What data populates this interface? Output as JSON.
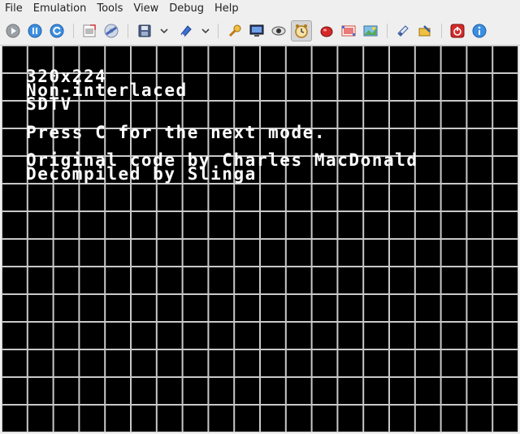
{
  "menu": {
    "file": "File",
    "emulation": "Emulation",
    "tools": "Tools",
    "view": "View",
    "debug": "Debug",
    "help": "Help"
  },
  "toolbar": {
    "items": [
      {
        "name": "play-icon"
      },
      {
        "name": "pause-icon"
      },
      {
        "name": "reset-icon"
      },
      {
        "name": "screenshot-icon"
      },
      {
        "name": "cd-icon"
      },
      {
        "name": "save-state-icon"
      },
      {
        "name": "load-state-icon"
      },
      {
        "name": "cheats-icon"
      },
      {
        "name": "display-icon"
      },
      {
        "name": "vram-icon"
      },
      {
        "name": "timer-icon"
      },
      {
        "name": "cpu-icon"
      },
      {
        "name": "memory-icon"
      },
      {
        "name": "palette-icon"
      },
      {
        "name": "patch-icon"
      },
      {
        "name": "settings-icon"
      },
      {
        "name": "power-icon"
      },
      {
        "name": "info-icon"
      }
    ]
  },
  "screen": {
    "line1": "320x224",
    "line2": "Non-interlaced",
    "line3": "SDTV",
    "line4": "Press C for the next mode.",
    "line5": "Original code by Charles MacDonald",
    "line6": "Decompiled by Slinga"
  },
  "colors": {
    "screen_bg": "#000000",
    "grid": "#c8c8c8",
    "text": "#ffffff"
  }
}
